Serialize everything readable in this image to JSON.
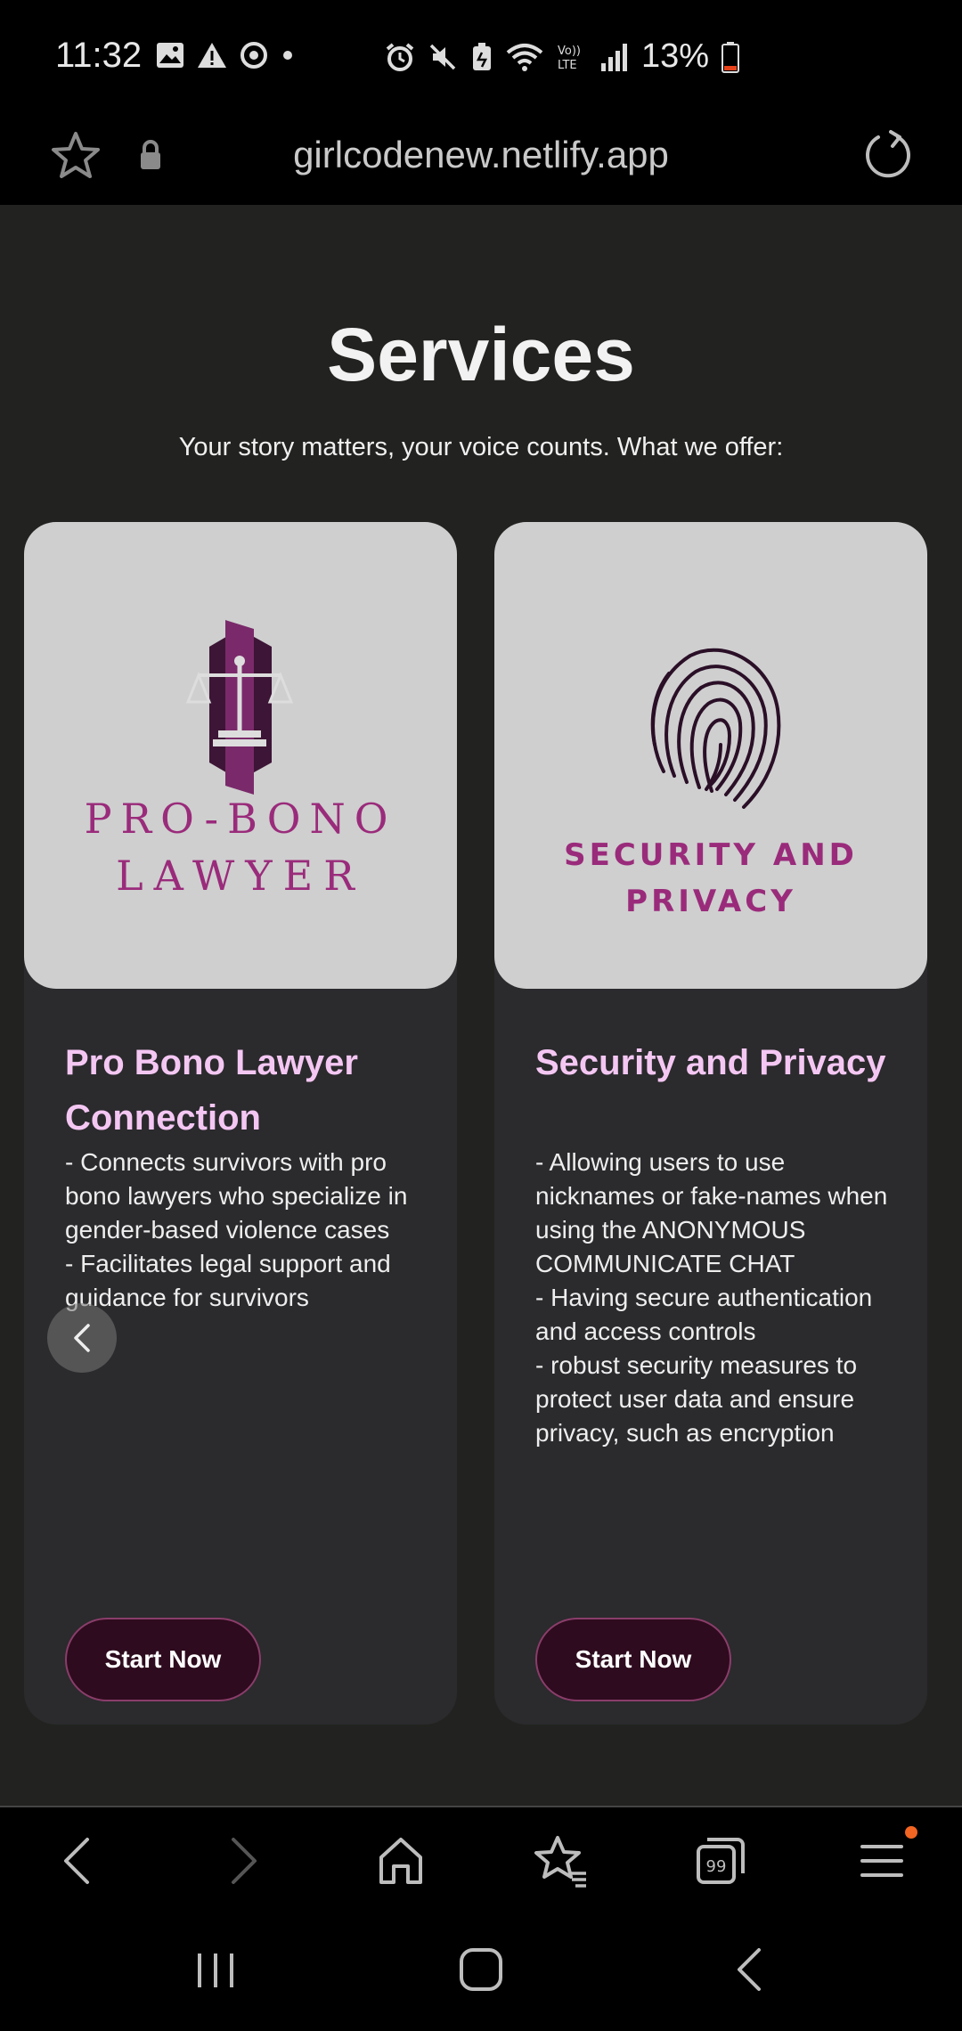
{
  "status_bar": {
    "time": "11:32",
    "battery": "13%",
    "icons": [
      "gallery-icon",
      "warning-icon",
      "sync-icon",
      "dot-icon",
      "alarm-icon",
      "mute-icon",
      "battery-saver-icon",
      "wifi-icon",
      "volte-icon",
      "signal-icon",
      "battery-icon"
    ]
  },
  "browser": {
    "url": "girlcodenew.netlify.app"
  },
  "page": {
    "title": "Services",
    "subtitle": "Your story matters, your voice counts. What we offer:",
    "cards": [
      {
        "logo_line1": "PRO-BONO",
        "logo_line2": "LAWYER",
        "title": "Pro Bono Lawyer Connection",
        "description": " - Connects survivors with pro bono lawyers who specialize in gender-based violence cases\n- Facilitates legal support and guidance for survivors",
        "button": "Start Now"
      },
      {
        "logo_line1": "SECURITY AND",
        "logo_line2": "PRIVACY",
        "title": "Security and Privacy",
        "description": "- Allowing users to use nicknames or fake-names when using the ANONYMOUS COMMUNICATE CHAT\n- Having secure authentication and access controls\n- robust security measures to protect user data and ensure privacy, such as encryption",
        "button": "Start Now"
      }
    ]
  },
  "colors": {
    "page_bg": "#222320",
    "card_bg": "#2b2a2d",
    "card_title": "#f4c7f3",
    "button_bg": "#2e0b1e",
    "logo_accent": "#9a2b7b"
  }
}
